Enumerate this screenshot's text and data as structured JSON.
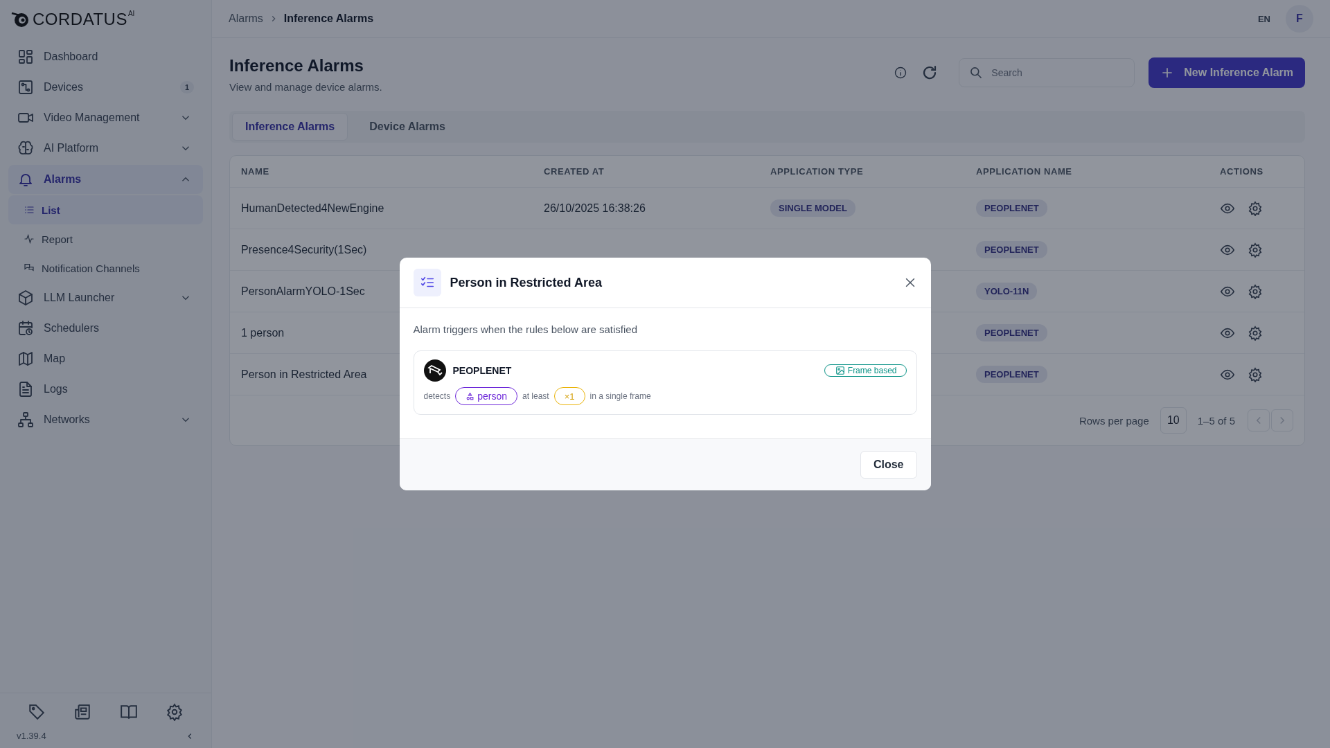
{
  "sidebar": {
    "logo": {
      "name": "CORDATUS",
      "suffix": "AI"
    },
    "items": [
      {
        "label": "Dashboard",
        "kind": "link",
        "selected": false
      },
      {
        "label": "Devices",
        "kind": "link",
        "selected": false,
        "badge": "1"
      },
      {
        "label": "Video Management",
        "kind": "group",
        "selected": false,
        "expanded": false
      },
      {
        "label": "AI Platform",
        "kind": "group",
        "selected": false,
        "expanded": false
      },
      {
        "label": "Alarms",
        "kind": "group",
        "selected": true,
        "expanded": true,
        "children": [
          {
            "label": "List",
            "selected": true
          },
          {
            "label": "Report",
            "selected": false
          },
          {
            "label": "Notification Channels",
            "selected": false
          }
        ]
      },
      {
        "label": "LLM Launcher",
        "kind": "group",
        "selected": false,
        "expanded": false
      },
      {
        "label": "Schedulers",
        "kind": "link",
        "selected": false
      },
      {
        "label": "Map",
        "kind": "link",
        "selected": false
      },
      {
        "label": "Logs",
        "kind": "link",
        "selected": false
      },
      {
        "label": "Networks",
        "kind": "group",
        "selected": false,
        "expanded": false
      }
    ],
    "version": "v1.39.4"
  },
  "topbar": {
    "breadcrumb": [
      "Alarms",
      "Inference Alarms"
    ],
    "language": "EN",
    "avatar": "F"
  },
  "page": {
    "title": "Inference Alarms",
    "subtitle": "View and manage device alarms.",
    "search": {
      "placeholder": "Search"
    },
    "new_button": "New Inference Alarm"
  },
  "tabs": [
    {
      "label": "Inference Alarms",
      "selected": true
    },
    {
      "label": "Device Alarms",
      "selected": false
    }
  ],
  "table": {
    "columns": [
      "NAME",
      "CREATED AT",
      "APPLICATION TYPE",
      "APPLICATION NAME",
      "ACTIONS"
    ],
    "rows": [
      {
        "name": "HumanDetected4NewEngine",
        "created_at": "26/10/2025 16:38:26",
        "application_type": "SINGLE MODEL",
        "application_name": "PEOPLENET"
      },
      {
        "name": "Presence4Security(1Sec)",
        "application_name": "PEOPLENET"
      },
      {
        "name": "PersonAlarmYOLO-1Sec",
        "application_name": "YOLO-11N"
      },
      {
        "name": "1 person",
        "application_name": "PEOPLENET"
      },
      {
        "name": "Person in Restricted Area",
        "application_name": "PEOPLENET"
      }
    ],
    "pagination": {
      "rows_per_page_label": "Rows per page",
      "rows_per_page": "10",
      "range": "1–5 of 5",
      "prev_disabled": true,
      "next_disabled": true
    }
  },
  "modal": {
    "title": "Person in Restricted Area",
    "description": "Alarm triggers when the rules below are satisfied",
    "rule": {
      "model": "PEOPLENET",
      "mode": "Frame based",
      "detects_label": "detects",
      "object": "person",
      "at_least_label": "at least",
      "count": "×1",
      "suffix": "in a single frame"
    },
    "close_button": "Close"
  }
}
